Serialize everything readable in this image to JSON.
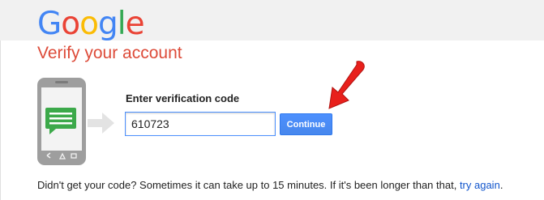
{
  "header": {
    "logo": [
      "G",
      "o",
      "o",
      "g",
      "l",
      "e"
    ],
    "logo_colors": [
      "#4285f4",
      "#ea4335",
      "#fbbc05",
      "#4285f4",
      "#34a853",
      "#ea4335"
    ]
  },
  "page": {
    "title": "Verify your account"
  },
  "form": {
    "label": "Enter verification code",
    "code_value": "610723",
    "continue_label": "Continue"
  },
  "help": {
    "text": "Didn't get your code? Sometimes it can take up to 15 minutes. If it's been longer than that, ",
    "link_text": "try again",
    "suffix": "."
  },
  "colors": {
    "accent_red": "#dd4b39",
    "button_blue": "#4d90fe",
    "link_blue": "#1155cc",
    "annotation_arrow": "#e8201c"
  },
  "icons": {
    "phone": "phone-with-sms-icon",
    "arrow": "right-arrow-icon",
    "annotation": "red-pointer-arrow-icon"
  }
}
